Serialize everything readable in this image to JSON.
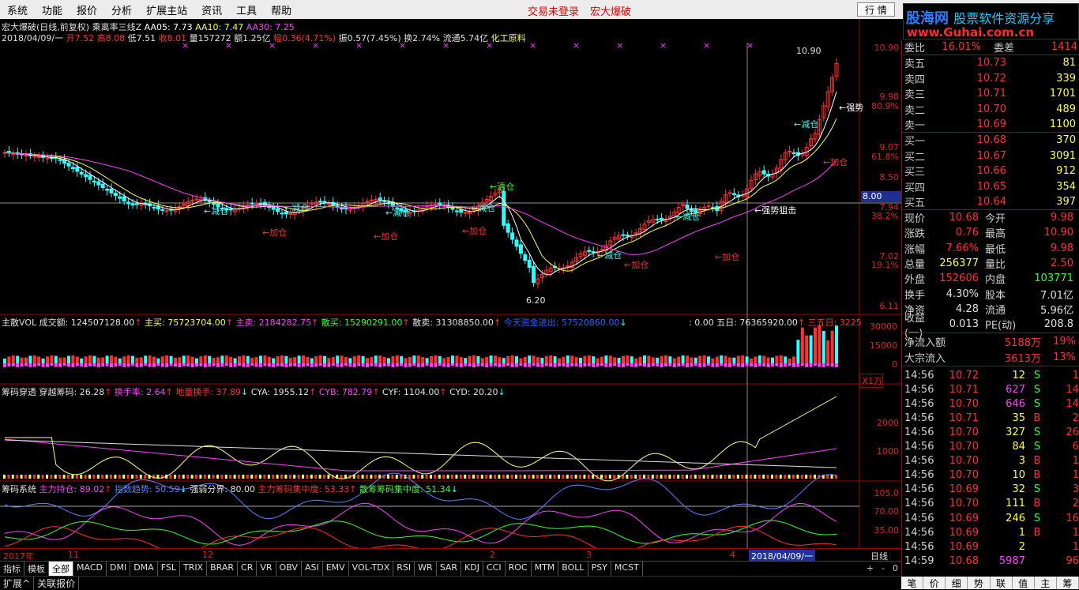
{
  "menu": {
    "items": [
      "系统",
      "功能",
      "报价",
      "分析",
      "扩展主站",
      "资讯",
      "工具",
      "帮助"
    ],
    "status_login": "交易未登录",
    "window_title": "宏大爆破",
    "mode_button": "行 情"
  },
  "logo": {
    "line1_a": "股海网",
    "line1_b": "股票软件资源分享",
    "line2": "www.Guhai.com.cn"
  },
  "chart": {
    "title": "宏大爆破(日线,前复权) 乘离率三线Z",
    "ma5": "AA05: 7.73",
    "ma10": "AA10: 7.47",
    "ma30": "AA30: 7.25",
    "quote_date": "2018/04/09/一",
    "quote_open": "开7.52",
    "quote_high": "高8.08",
    "quote_low": "低7.51",
    "quote_close": "收8.01",
    "quote_vol": "量157272",
    "quote_amount": "额1.25亿",
    "quote_change": "幅0.36(4.71%)",
    "quote_amp": "振0.57(7.45%)",
    "quote_turn": "换2.74%",
    "quote_float": "流通5.74亿",
    "quote_sector": "化工原料",
    "price_axis": [
      "10.90",
      "9.98",
      "80.9%",
      "9.07",
      "61.8%",
      "8.50",
      "7.94",
      "38.2%",
      "7.02",
      "19.1%",
      "6.11"
    ],
    "cursor_price": "8.00",
    "max_label": "10.90",
    "min_label": "6.20",
    "signals": {
      "strong": "←强势",
      "strong_snipe": "←强势狙击",
      "clear": "←清仓",
      "reduce": "←减仓",
      "add": "←加仓"
    },
    "vol_header": {
      "name": "主散VOL",
      "amount": "成交额: 124507128.00",
      "main_buy": "主买: 75723704.00",
      "main_sell": "主卖: 2184282.75",
      "retail_buy": "散买: 15290291.00",
      "retail_sell": "散卖: 31308850.00",
      "today_flow": "今天资金进出: 57520860.00",
      "blank": ": 0.00",
      "five_day": "五日: 76365920.00",
      "three_five": "三五日: 3225"
    },
    "vol_axis": [
      "30000",
      "15000",
      "0",
      "X1万"
    ],
    "chip_header": {
      "name": "筹码穿透",
      "cross": "穿越筹码: 26.28",
      "turnover": "换手率: 2.64",
      "ground": "地量换手: 37.89",
      "cya": "CYA: 1955.12",
      "cyb": "CYB: 782.79",
      "cyf": "CYF: 1104.00",
      "cyd": "CYD: 20.20"
    },
    "chip_axis": [
      "2000",
      "1000"
    ],
    "sys_header": {
      "name": "筹码系统",
      "main_hold": "主力持仓: 89.02",
      "index_trend": "指数趋势: 50.59",
      "divide": "强弱分界: 80.00",
      "main_conc": "主力筹码集中度: 53.33",
      "retail_conc": "散筹筹码集中度: 51.34"
    },
    "sys_axis": [
      "105.0",
      "70.00",
      "35.00"
    ],
    "date_axis": [
      "2017年",
      "11",
      "12",
      "2",
      "3",
      "4",
      "2018/04/09/一"
    ],
    "period": "日线"
  },
  "tabs": [
    "指标",
    "模板",
    "全部",
    "MACD",
    "DMI",
    "DMA",
    "FSL",
    "TRIX",
    "BRAR",
    "CR",
    "VR",
    "OBV",
    "ASI",
    "EMV",
    "VOL-TDX",
    "RSI",
    "WR",
    "SAR",
    "KDJ",
    "CCI",
    "ROC",
    "MTM",
    "BOLL",
    "PSY",
    "MCST"
  ],
  "tab_nav": [
    "+",
    "-",
    "0"
  ],
  "bottom": [
    "扩展^",
    "关联报价"
  ],
  "orderbook": {
    "wb_label": "委比",
    "wb_value": "16.01%",
    "wc_label": "委差",
    "wc_value": "1414",
    "sell": [
      {
        "k": "卖五",
        "p": "10.73",
        "v": "81"
      },
      {
        "k": "卖四",
        "p": "10.72",
        "v": "339"
      },
      {
        "k": "卖三",
        "p": "10.71",
        "v": "1701"
      },
      {
        "k": "卖二",
        "p": "10.70",
        "v": "489"
      },
      {
        "k": "卖一",
        "p": "10.69",
        "v": "1100"
      }
    ],
    "buy": [
      {
        "k": "买一",
        "p": "10.68",
        "v": "370"
      },
      {
        "k": "买二",
        "p": "10.67",
        "v": "3091"
      },
      {
        "k": "买三",
        "p": "10.66",
        "v": "912"
      },
      {
        "k": "买四",
        "p": "10.65",
        "v": "354"
      },
      {
        "k": "买五",
        "p": "10.64",
        "v": "397"
      }
    ]
  },
  "stats": [
    {
      "a": "现价",
      "b": "10.68",
      "c": "今开",
      "d": "9.98",
      "bc": "#ff3030",
      "dc": "#ff3030"
    },
    {
      "a": "涨跌",
      "b": "0.76",
      "c": "最高",
      "d": "10.90",
      "bc": "#ff3030",
      "dc": "#ff3030"
    },
    {
      "a": "涨幅",
      "b": "7.66%",
      "c": "最低",
      "d": "9.98",
      "bc": "#ff3030",
      "dc": "#ff3030"
    },
    {
      "a": "总量",
      "b": "256377",
      "c": "量比",
      "d": "2.50",
      "bc": "#ffff40",
      "dc": "#ff3030"
    },
    {
      "a": "外盘",
      "b": "152606",
      "c": "内盘",
      "d": "103771",
      "bc": "#ff3030",
      "dc": "#30ff30"
    },
    {
      "a": "换手",
      "b": "4.30%",
      "c": "股本",
      "d": "7.01亿",
      "bc": "#e0e0e0",
      "dc": "#e0e0e0"
    },
    {
      "a": "净资",
      "b": "4.28",
      "c": "流通",
      "d": "5.96亿",
      "bc": "#e0e0e0",
      "dc": "#e0e0e0"
    },
    {
      "a": "收益(一)",
      "b": "0.013",
      "c": "PE(动)",
      "d": "208.8",
      "bc": "#e0e0e0",
      "dc": "#e0e0e0"
    }
  ],
  "flow": [
    {
      "k": "净流入额",
      "v": "5188万",
      "p": "19%"
    },
    {
      "k": "大宗流入",
      "v": "3613万",
      "p": "13%"
    }
  ],
  "ticks": [
    {
      "t": "14:56",
      "p": "10.72",
      "q": "12",
      "s": "S",
      "n": "1",
      "qc": "#ffff40"
    },
    {
      "t": "14:56",
      "p": "10.71",
      "q": "627",
      "s": "S",
      "n": "14",
      "qc": "#ff40ff"
    },
    {
      "t": "14:56",
      "p": "10.70",
      "q": "646",
      "s": "S",
      "n": "14",
      "qc": "#ff40ff"
    },
    {
      "t": "14:56",
      "p": "10.71",
      "q": "35",
      "s": "B",
      "n": "2",
      "qc": "#ffff40"
    },
    {
      "t": "14:56",
      "p": "10.70",
      "q": "327",
      "s": "S",
      "n": "26",
      "qc": "#ffff40"
    },
    {
      "t": "14:56",
      "p": "10.70",
      "q": "84",
      "s": "S",
      "n": "6",
      "qc": "#ffff40"
    },
    {
      "t": "14:56",
      "p": "10.70",
      "q": "3",
      "s": "B",
      "n": "1",
      "qc": "#ffff40"
    },
    {
      "t": "14:56",
      "p": "10.70",
      "q": "10",
      "s": "B",
      "n": "1",
      "qc": "#ffff40"
    },
    {
      "t": "14:56",
      "p": "10.69",
      "q": "32",
      "s": "S",
      "n": "3",
      "qc": "#ffff40"
    },
    {
      "t": "14:56",
      "p": "10.70",
      "q": "111",
      "s": "B",
      "n": "2",
      "qc": "#ffff40"
    },
    {
      "t": "14:56",
      "p": "10.69",
      "q": "246",
      "s": "S",
      "n": "16",
      "qc": "#ffff40"
    },
    {
      "t": "14:56",
      "p": "10.69",
      "q": "1",
      "s": "B",
      "n": "1",
      "qc": "#ffff40"
    },
    {
      "t": "14:56",
      "p": "10.69",
      "q": "2",
      "s": "",
      "n": "1",
      "qc": "#ffff40"
    },
    {
      "t": "14:59",
      "p": "10.68",
      "q": "5987",
      "s": "",
      "n": "96",
      "qc": "#ff40ff"
    }
  ],
  "right_tabs": [
    "笔",
    "价",
    "细",
    "势",
    "联",
    "值",
    "主",
    "筹"
  ],
  "colors": {
    "up": "#ff3030",
    "down": "#30ffff",
    "ma5": "#ffffff",
    "ma10": "#ffff40",
    "ma30": "#ff40ff",
    "frame": "#a00000"
  }
}
